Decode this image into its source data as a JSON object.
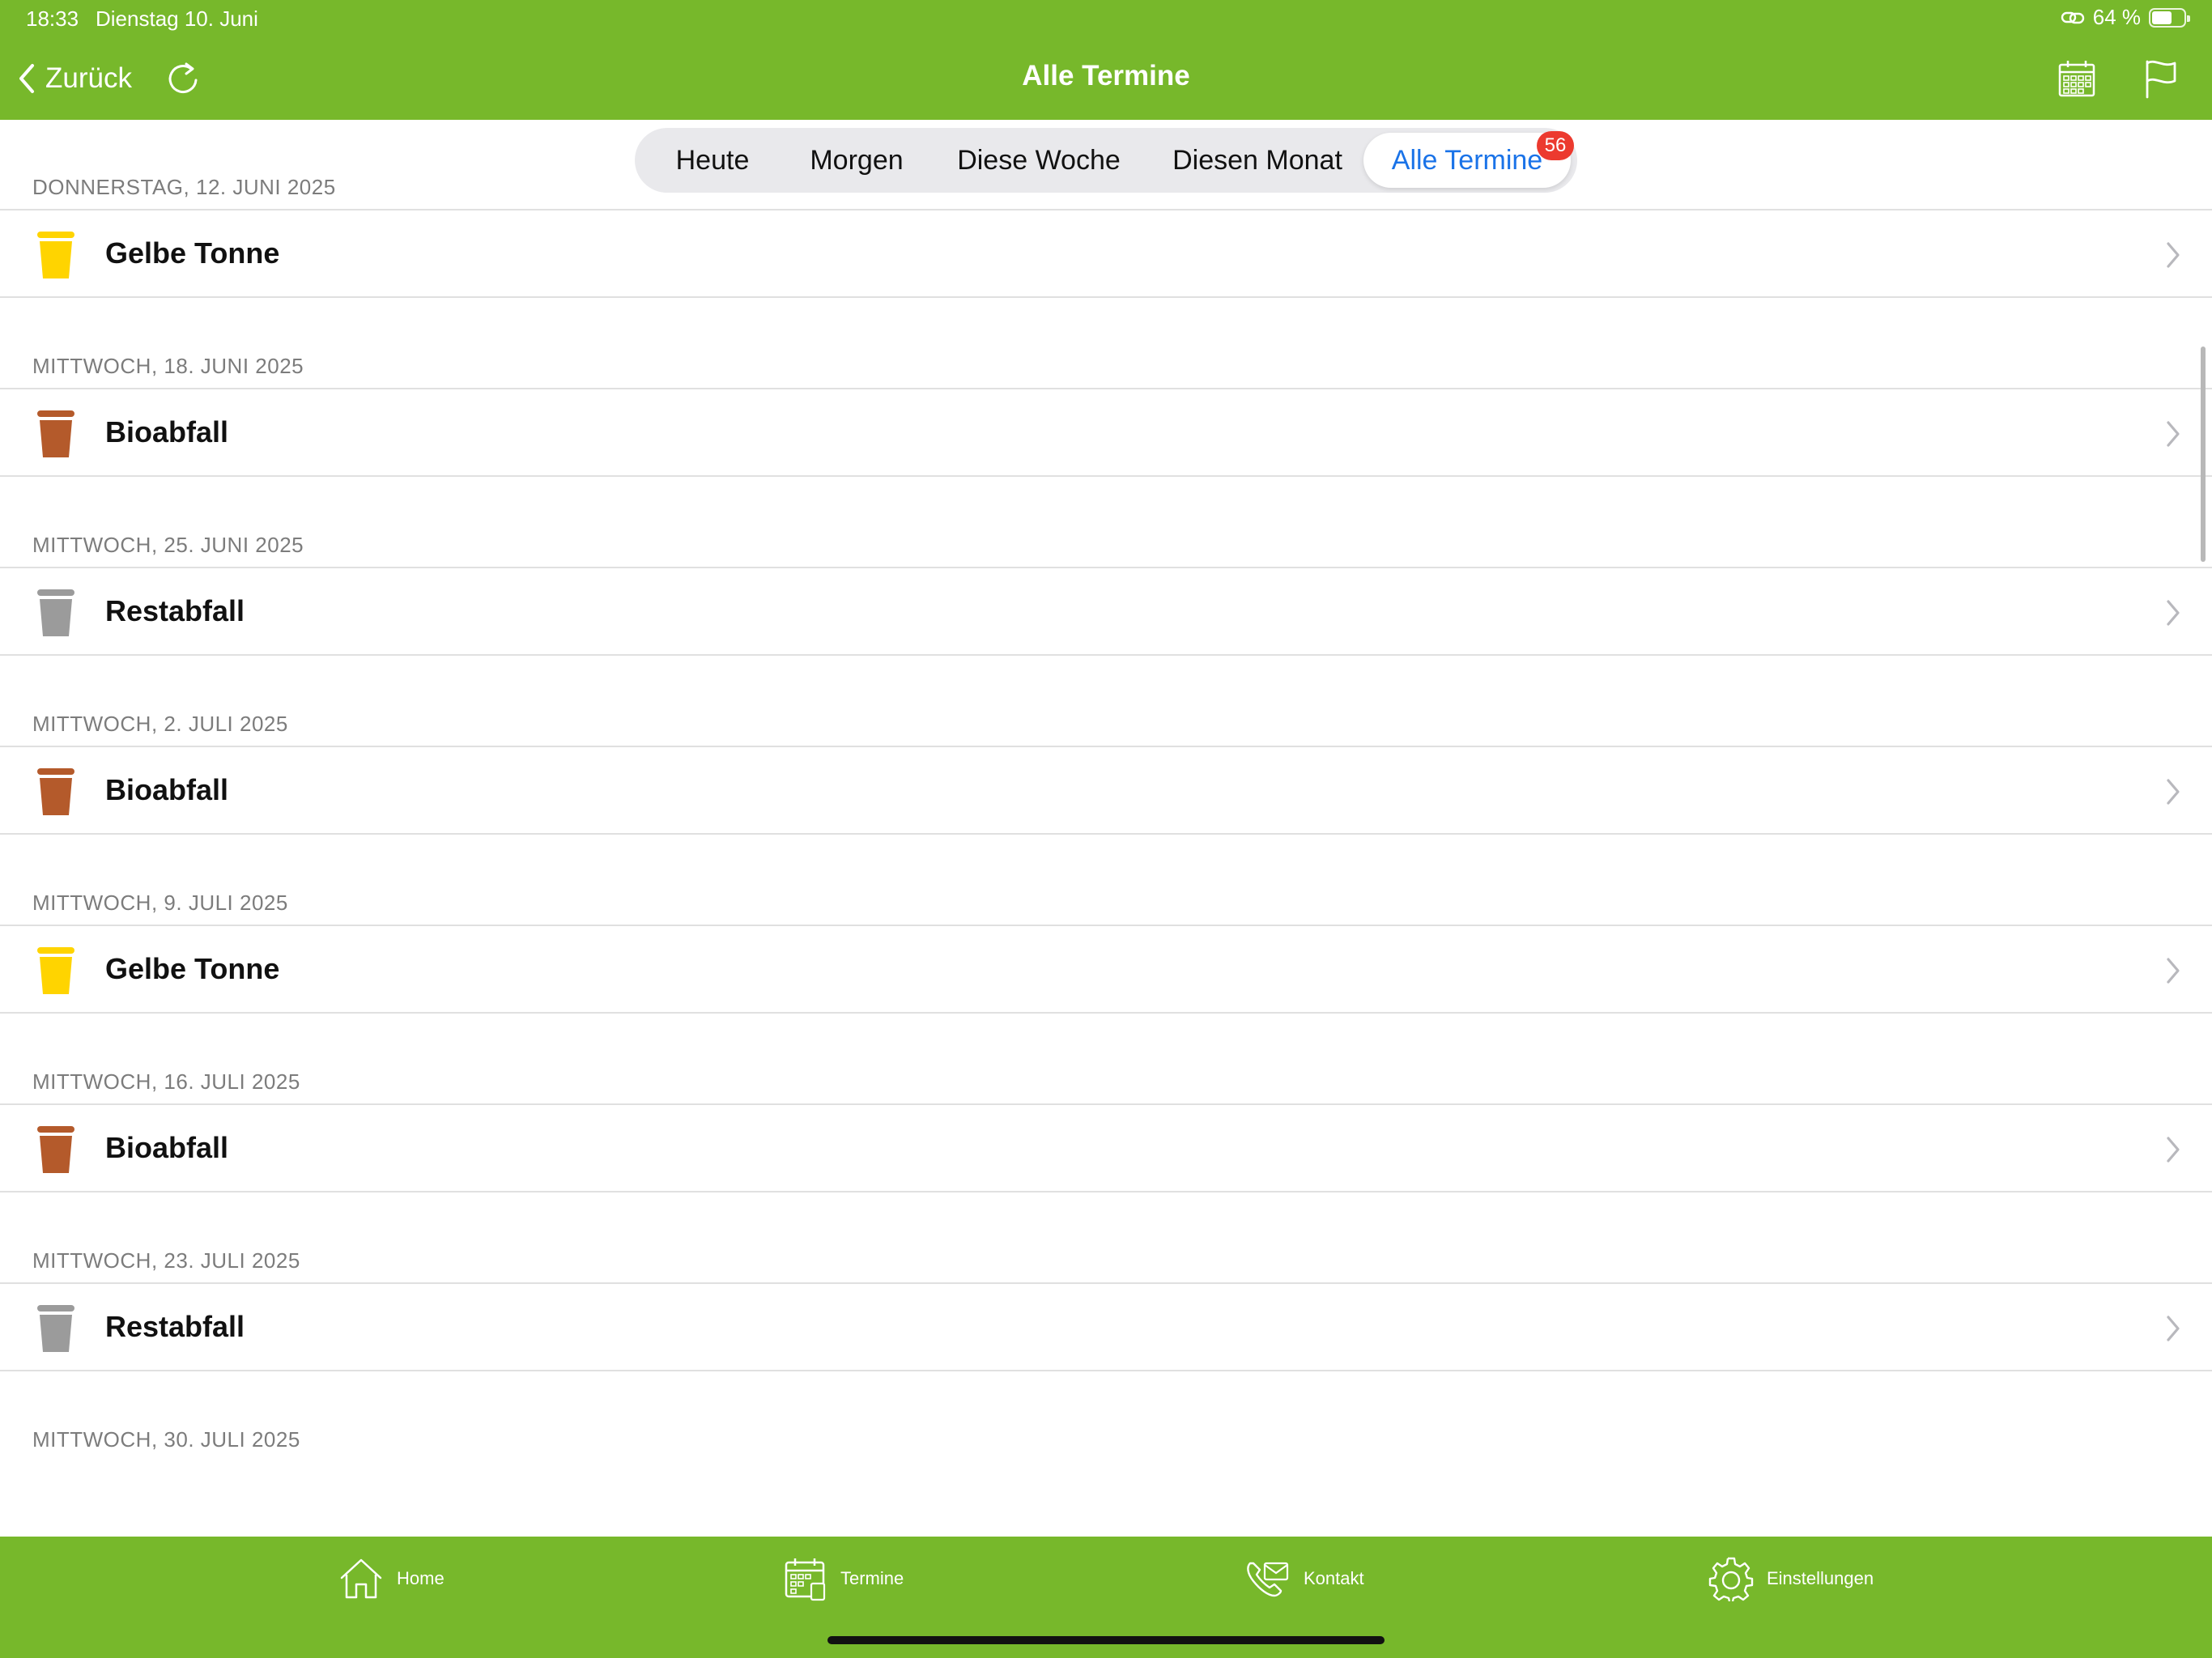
{
  "status_bar": {
    "time": "18:33",
    "date": "Dienstag 10. Juni",
    "battery_text": "64 %",
    "battery_level": 0.64
  },
  "nav": {
    "back_label": "Zurück",
    "title": "Alle Termine"
  },
  "segments": [
    "Heute",
    "Morgen",
    "Diese Woche",
    "Diesen Monat",
    "Alle Termine"
  ],
  "active_segment": "Alle Termine",
  "badge_count": "56",
  "entries": [
    {
      "date": "DONNERSTAG, 12. JUNI 2025",
      "label": "Gelbe Tonne",
      "bin_color": "#ffd400"
    },
    {
      "date": "MITTWOCH, 18. JUNI 2025",
      "label": "Bioabfall",
      "bin_color": "#b45a2b"
    },
    {
      "date": "MITTWOCH, 25. JUNI 2025",
      "label": "Restabfall",
      "bin_color": "#9b9b9b"
    },
    {
      "date": "MITTWOCH, 2. JULI 2025",
      "label": "Bioabfall",
      "bin_color": "#b45a2b"
    },
    {
      "date": "MITTWOCH, 9. JULI 2025",
      "label": "Gelbe Tonne",
      "bin_color": "#ffd400"
    },
    {
      "date": "MITTWOCH, 16. JULI 2025",
      "label": "Bioabfall",
      "bin_color": "#b45a2b"
    },
    {
      "date": "MITTWOCH, 23. JULI 2025",
      "label": "Restabfall",
      "bin_color": "#9b9b9b"
    },
    {
      "date": "MITTWOCH, 30. JULI 2025",
      "label": "",
      "bin_color": ""
    }
  ],
  "tabbar": {
    "home": "Home",
    "termine": "Termine",
    "kontakt": "Kontakt",
    "einstellungen": "Einstellungen"
  },
  "colors": {
    "brand_green": "#77b82b",
    "accent_blue": "#1a73e8",
    "badge_red": "#ec3a2f"
  }
}
